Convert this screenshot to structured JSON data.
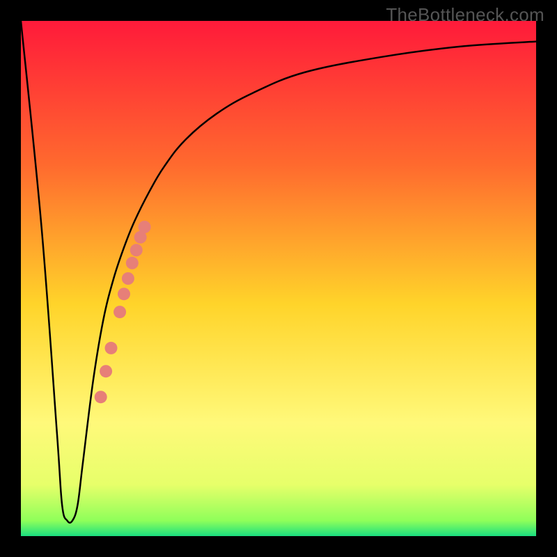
{
  "watermark": "TheBottleneck.com",
  "chart_data": {
    "type": "line",
    "title": "",
    "xlabel": "",
    "ylabel": "",
    "xlim": [
      0,
      100
    ],
    "ylim": [
      0,
      100
    ],
    "grid": false,
    "legend": false,
    "background_gradient": {
      "stops": [
        {
          "offset": 0.0,
          "color": "#ff1a3a"
        },
        {
          "offset": 0.28,
          "color": "#ff6a2e"
        },
        {
          "offset": 0.55,
          "color": "#ffd42a"
        },
        {
          "offset": 0.78,
          "color": "#fff97a"
        },
        {
          "offset": 0.9,
          "color": "#e7ff6a"
        },
        {
          "offset": 0.97,
          "color": "#8fff5a"
        },
        {
          "offset": 1.0,
          "color": "#1adf80"
        }
      ]
    },
    "series": [
      {
        "name": "bottleneck-curve",
        "color": "#000000",
        "x": [
          0,
          4,
          7,
          8,
          9,
          10,
          11,
          12,
          14,
          16,
          18,
          20,
          22,
          25,
          28,
          32,
          38,
          45,
          55,
          70,
          85,
          100
        ],
        "y": [
          100,
          60,
          20,
          6,
          3,
          3,
          6,
          14,
          30,
          42,
          50,
          56,
          61,
          67,
          72,
          77,
          82,
          86,
          90,
          93,
          95,
          96
        ]
      }
    ],
    "markers": {
      "name": "highlight-points",
      "color": "#e77f78",
      "radius": 9,
      "points": [
        {
          "x": 15.5,
          "y": 27.0
        },
        {
          "x": 16.5,
          "y": 32.0
        },
        {
          "x": 17.5,
          "y": 36.5
        },
        {
          "x": 19.2,
          "y": 43.5
        },
        {
          "x": 20.0,
          "y": 47.0
        },
        {
          "x": 20.8,
          "y": 50.0
        },
        {
          "x": 21.6,
          "y": 53.0
        },
        {
          "x": 22.4,
          "y": 55.5
        },
        {
          "x": 23.2,
          "y": 58.0
        },
        {
          "x": 24.0,
          "y": 60.0
        }
      ]
    }
  }
}
